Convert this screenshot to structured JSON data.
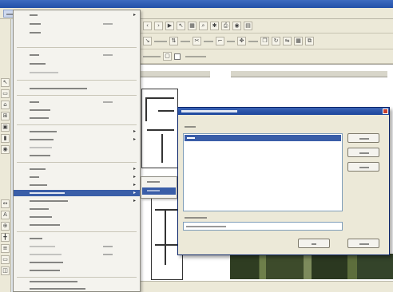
{
  "colors": {
    "title_bar": "#2250a8",
    "menu_highlight": "#3a5ea8",
    "chrome": "#ece9d8",
    "close_button": "#c8402c"
  },
  "menubar": {
    "items": [
      "",
      "",
      "",
      "",
      ""
    ],
    "active_index": 0
  },
  "file_menu": {
    "highlighted_index": 27,
    "items": [
      {
        "label": "",
        "submenu": true
      },
      {
        "label": "",
        "shortcut": ""
      },
      {
        "label": ""
      },
      {
        "separator": true
      },
      {
        "label": "",
        "shortcut": ""
      },
      {
        "label": ""
      },
      {
        "label": "",
        "disabled": true
      },
      {
        "separator": true
      },
      {
        "label": ""
      },
      {
        "separator": true
      },
      {
        "label": "",
        "shortcut": ""
      },
      {
        "label": ""
      },
      {
        "label": ""
      },
      {
        "separator": true
      },
      {
        "label": "",
        "submenu": true
      },
      {
        "label": "",
        "submenu": true
      },
      {
        "label": "",
        "disabled": true
      },
      {
        "label": ""
      },
      {
        "separator": true
      },
      {
        "label": "",
        "submenu": true
      },
      {
        "label": "",
        "submenu": true
      },
      {
        "label": "",
        "submenu": true
      },
      {
        "label": "",
        "submenu": true
      },
      {
        "label": "",
        "submenu": true
      },
      {
        "label": ""
      },
      {
        "label": ""
      },
      {
        "label": ""
      },
      {
        "separator": true
      },
      {
        "label": ""
      },
      {
        "label": "",
        "disabled": true
      },
      {
        "label": "",
        "disabled": true
      },
      {
        "label": ""
      },
      {
        "label": ""
      },
      {
        "separator": true
      },
      {
        "label": ""
      },
      {
        "label": ""
      },
      {
        "label": ""
      }
    ]
  },
  "submenu": {
    "items": [
      "",
      ""
    ],
    "highlighted_index": 1
  },
  "dialog": {
    "title": "",
    "list_label": "",
    "list_items": [
      ""
    ],
    "buttons": [
      "",
      "",
      ""
    ],
    "file_name_label": "",
    "file_name_value": "",
    "ok": "",
    "cancel": ""
  },
  "toolbar": {
    "option_label": ""
  }
}
